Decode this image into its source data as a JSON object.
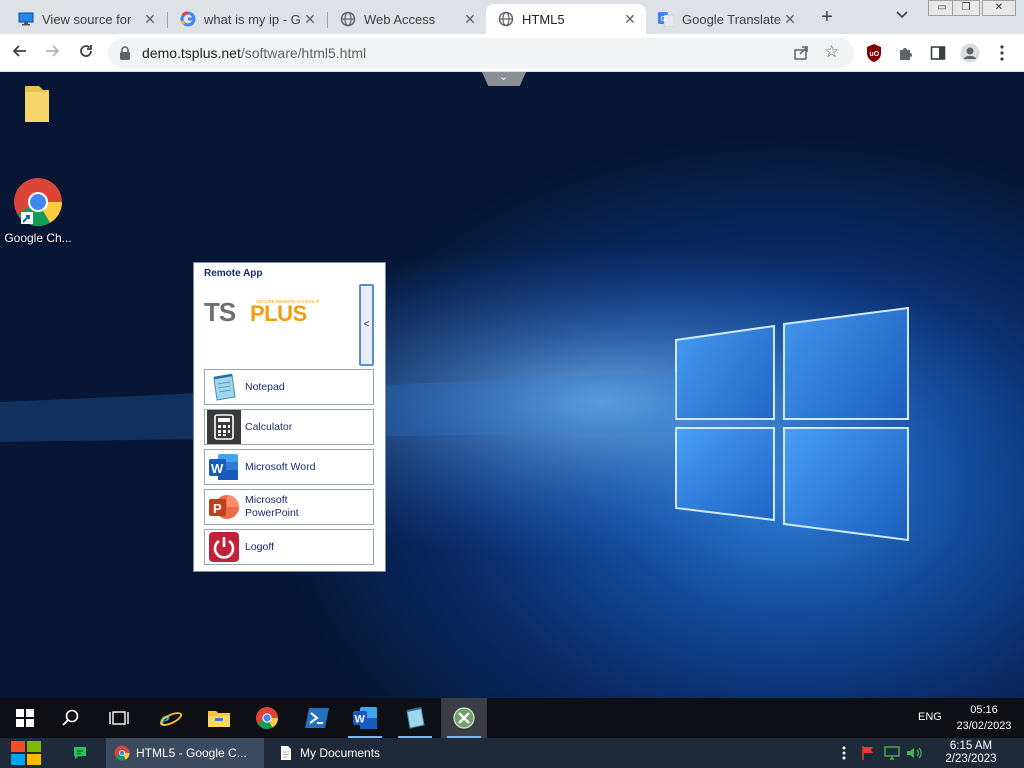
{
  "browser": {
    "tabs": [
      {
        "title": "View source for",
        "icon": "monitor-icon",
        "active": false
      },
      {
        "title": "what is my ip - G",
        "icon": "google-icon",
        "active": false
      },
      {
        "title": "Web Access",
        "icon": "globe-icon",
        "active": false
      },
      {
        "title": "HTML5",
        "icon": "globe-icon",
        "active": true
      },
      {
        "title": "Google Translate",
        "icon": "google-translate-icon",
        "active": false
      }
    ],
    "new_tab_label": "+",
    "address": {
      "host": "demo.tsplus.net",
      "path": "/software/html5.html"
    }
  },
  "desktop": {
    "icons": [
      {
        "label": "",
        "icon": "folder-icon"
      },
      {
        "label": "Google Ch...",
        "icon": "chrome-icon"
      }
    ]
  },
  "remote_app": {
    "title": "Remote App",
    "logo_text": "TSPLUS",
    "logo_tagline": "SECURE REMOTE ACCESS",
    "collapse_label": "<",
    "apps": [
      {
        "label": "Notepad",
        "icon": "notepad-icon"
      },
      {
        "label": "Calculator",
        "icon": "calculator-icon"
      },
      {
        "label": "Microsoft Word",
        "icon": "word-icon"
      },
      {
        "label": "Microsoft\nPowerPoint",
        "icon": "powerpoint-icon"
      },
      {
        "label": "Logoff",
        "icon": "power-icon"
      }
    ]
  },
  "remote_taskbar": {
    "language": "ENG",
    "time": "05:16",
    "date": "23/02/2023"
  },
  "host_taskbar": {
    "apps": [
      {
        "label": "HTML5 - Google C...",
        "icon": "chrome-icon",
        "active": true
      },
      {
        "label": "My Documents",
        "icon": "document-icon",
        "active": false
      }
    ],
    "time": "6:15 AM",
    "date": "2/23/2023"
  },
  "colors": {
    "panel_text": "#1a2a6c",
    "tsplus_gray": "#6d6e71",
    "tsplus_orange": "#f39c12"
  }
}
